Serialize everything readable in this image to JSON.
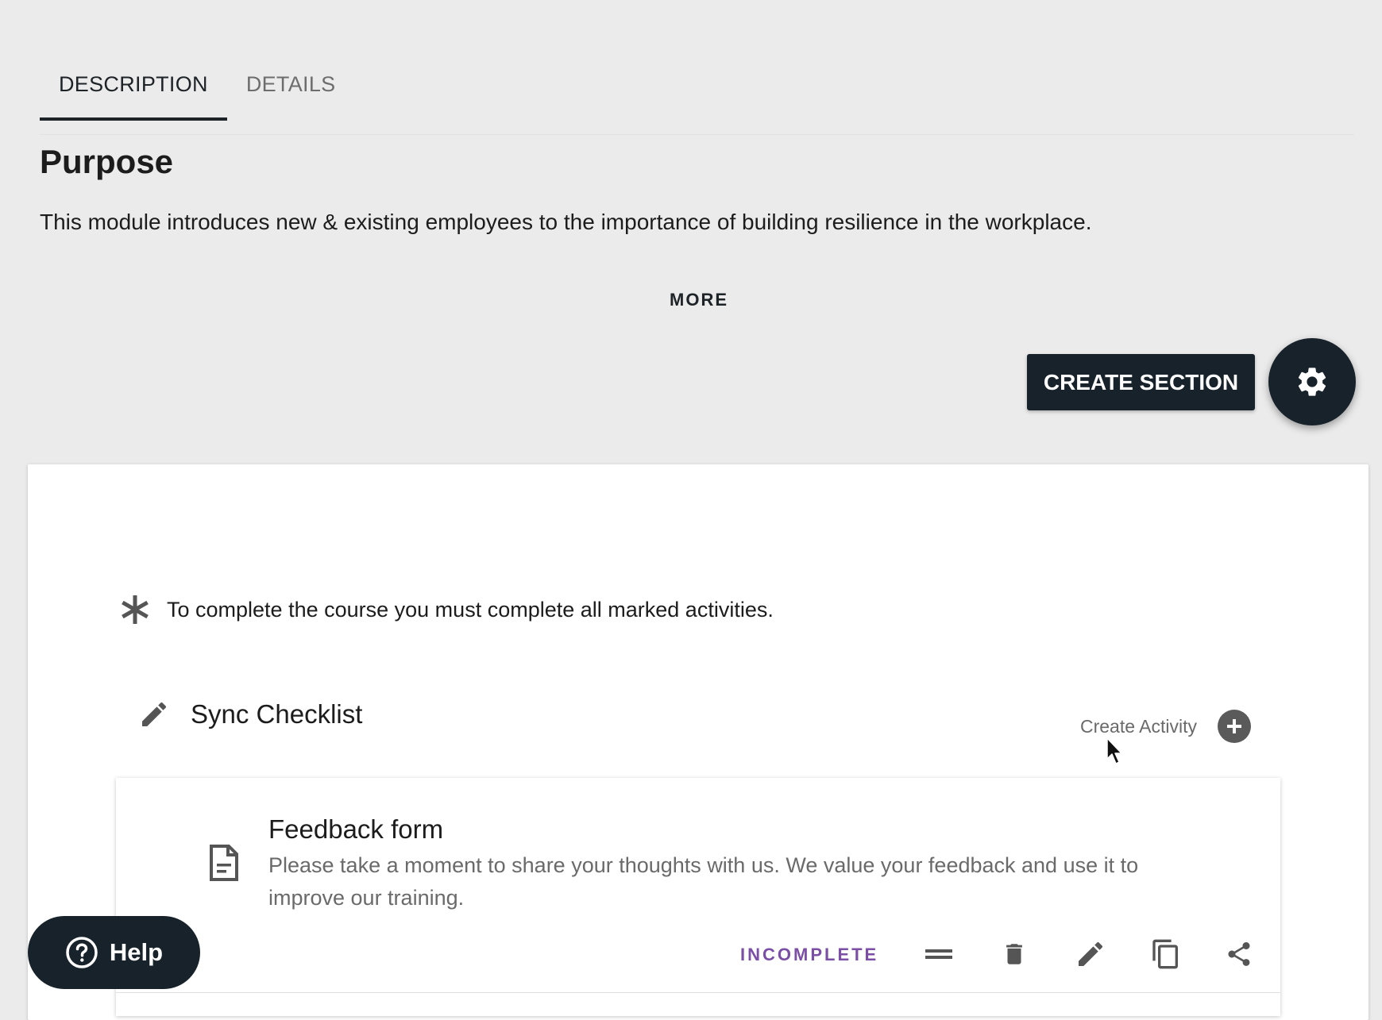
{
  "tabs": [
    {
      "label": "DESCRIPTION",
      "active": true
    },
    {
      "label": "DETAILS",
      "active": false
    }
  ],
  "purpose": {
    "title": "Purpose",
    "text": "This module introduces new & existing employees to the importance of building resilience in the workplace.",
    "more_label": "MORE"
  },
  "toolbar": {
    "create_section_label": "CREATE SECTION",
    "settings_icon": "gear-icon"
  },
  "course": {
    "required_note": "To complete the course you must complete all marked activities.",
    "section": {
      "title": "Sync Checklist",
      "create_activity_label": "Create Activity"
    },
    "activity": {
      "title": "Feedback form",
      "description": "Please take a moment to share your thoughts with us. We value your feedback and use it to improve our training.",
      "status": "INCOMPLETE",
      "icons": [
        "drag-handle-icon",
        "trash-icon",
        "edit-icon",
        "copy-icon",
        "share-icon"
      ]
    }
  },
  "help": {
    "label": "Help"
  },
  "colors": {
    "background": "#ebebeb",
    "dark": "#18222b",
    "status_purple": "#7b4fa5"
  }
}
